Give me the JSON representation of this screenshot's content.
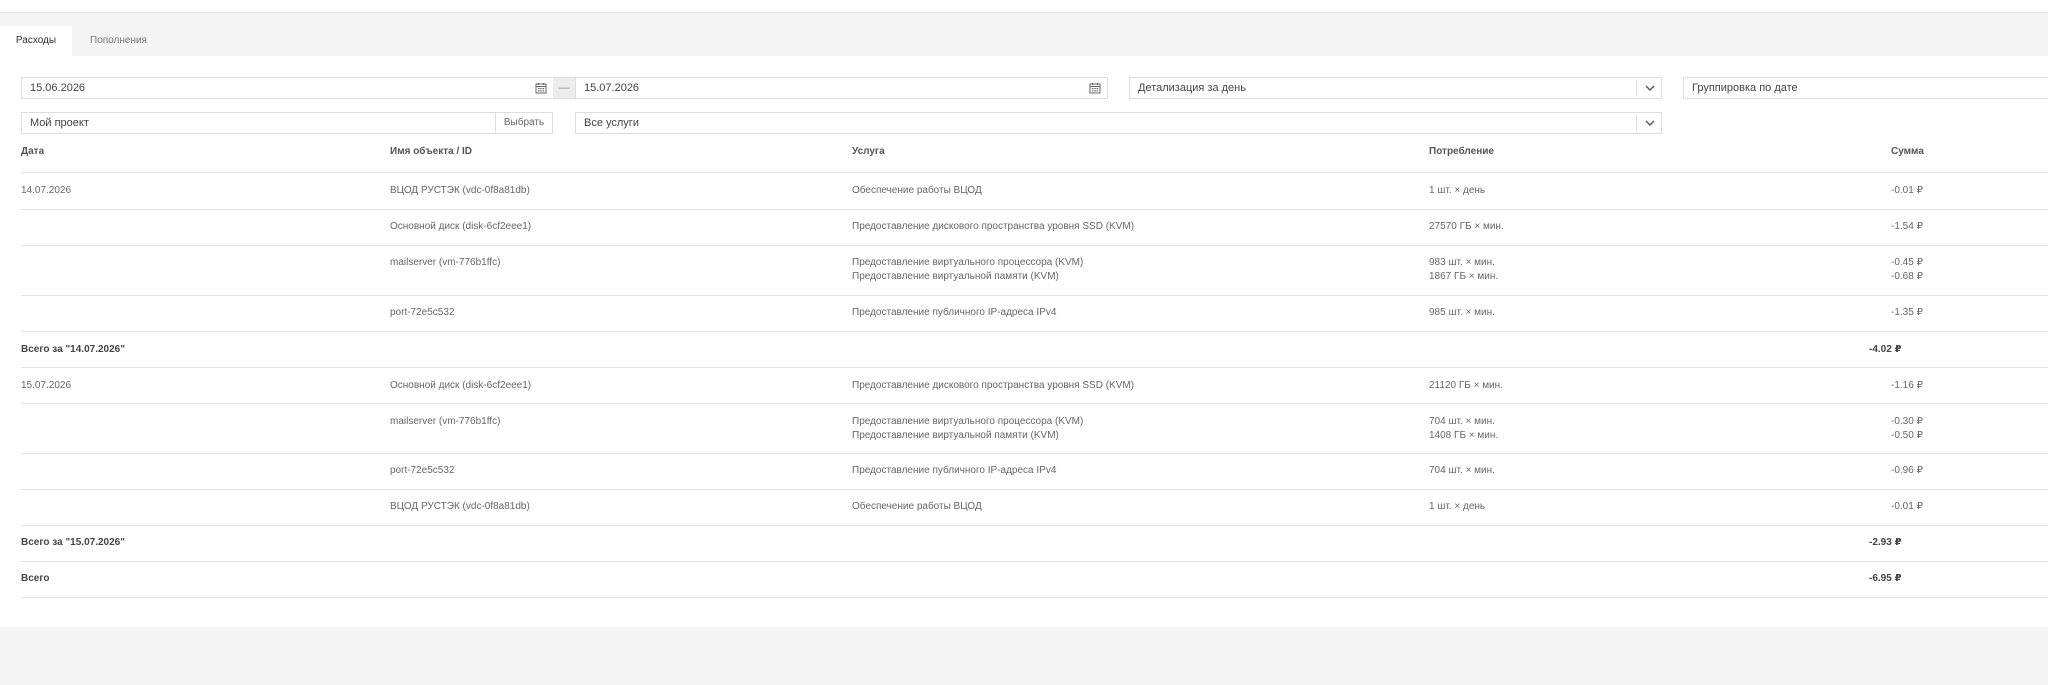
{
  "tabs": [
    {
      "label": "Расходы",
      "active": true
    },
    {
      "label": "Пополнения",
      "active": false
    }
  ],
  "filters": {
    "date_from": "15.06.2026",
    "date_to": "15.07.2026",
    "date_separator": "—",
    "detail": "Детализация за день",
    "grouping": "Группировка по дате",
    "project": "Мой проект",
    "choose_button": "Выбрать",
    "services": "Все услуги"
  },
  "table": {
    "headers": {
      "date": "Дата",
      "object": "Имя объекта / ID",
      "service": "Услуга",
      "usage": "Потребление",
      "sum": "Сумма"
    },
    "rows": [
      {
        "date": "14.07.2026",
        "object": "ВЦОД РУСТЭК (vdc-0f8a81db)",
        "services": [
          "Обеспечение работы ВЦОД"
        ],
        "usage": [
          "1 шт. × день"
        ],
        "sums": [
          "-0.01 ₽"
        ]
      },
      {
        "date": "",
        "object": "Основной диск (disk-6cf2eee1)",
        "services": [
          "Предоставление дискового пространства уровня SSD (KVM)"
        ],
        "usage": [
          "27570 ГБ × мин."
        ],
        "sums": [
          "-1.54 ₽"
        ]
      },
      {
        "date": "",
        "object": "mailserver (vm-776b1ffc)",
        "services": [
          "Предоставление виртуального процессора (KVM)",
          "Предоставление виртуальной памяти (KVM)"
        ],
        "usage": [
          "983 шт. × мин.",
          "1867 ГБ × мин."
        ],
        "sums": [
          "-0.45 ₽",
          "-0.68 ₽"
        ]
      },
      {
        "date": "",
        "object": "port-72e5c532",
        "services": [
          "Предоставление публичного IP-адреса IPv4"
        ],
        "usage": [
          "985 шт. × мин."
        ],
        "sums": [
          "-1.35 ₽"
        ]
      },
      {
        "total_label": "Всего за \"14.07.2026\"",
        "total": "-4.02 ₽"
      },
      {
        "date": "15.07.2026",
        "object": "Основной диск (disk-6cf2eee1)",
        "services": [
          "Предоставление дискового пространства уровня SSD (KVM)"
        ],
        "usage": [
          "21120 ГБ × мин."
        ],
        "sums": [
          "-1.16 ₽"
        ]
      },
      {
        "date": "",
        "object": "mailserver (vm-776b1ffc)",
        "services": [
          "Предоставление виртуального процессора (KVM)",
          "Предоставление виртуальной памяти (KVM)"
        ],
        "usage": [
          "704 шт. × мин.",
          "1408 ГБ × мин."
        ],
        "sums": [
          "-0.30 ₽",
          "-0.50 ₽"
        ]
      },
      {
        "date": "",
        "object": "port-72e5c532",
        "services": [
          "Предоставление публичного IP-адреса IPv4"
        ],
        "usage": [
          "704 шт. × мин."
        ],
        "sums": [
          "-0.96 ₽"
        ]
      },
      {
        "date": "",
        "object": "ВЦОД РУСТЭК (vdc-0f8a81db)",
        "services": [
          "Обеспечение работы ВЦОД"
        ],
        "usage": [
          "1 шт. × день"
        ],
        "sums": [
          "-0.01 ₽"
        ]
      },
      {
        "total_label": "Всего за \"15.07.2026\"",
        "total": "-2.93 ₽"
      },
      {
        "total_label": "Всего",
        "total": "-6.95 ₽"
      }
    ]
  },
  "icons": {
    "calendar": "calendar-icon",
    "chevron": "chevron-down-icon"
  }
}
